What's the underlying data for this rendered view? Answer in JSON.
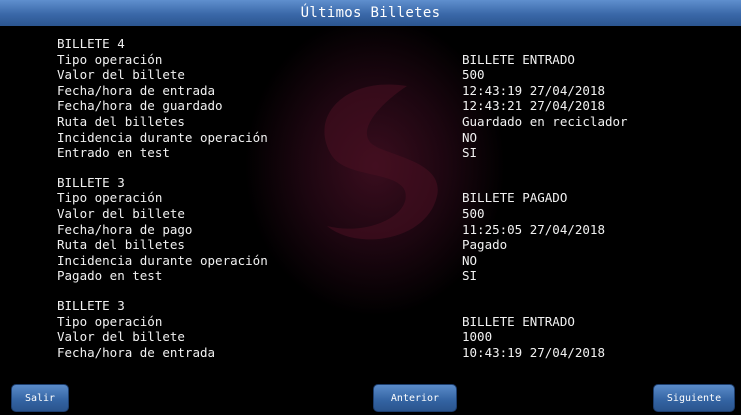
{
  "header": {
    "title": "Últimos Billetes"
  },
  "records": [
    {
      "title": "BILLETE 4",
      "rows": [
        {
          "label": "Tipo operación",
          "value": "BILLETE ENTRADO"
        },
        {
          "label": "Valor del billete",
          "value": "500"
        },
        {
          "label": "Fecha/hora de entrada",
          "value": "12:43:19 27/04/2018"
        },
        {
          "label": "Fecha/hora de guardado",
          "value": "12:43:21 27/04/2018"
        },
        {
          "label": "Ruta del billetes",
          "value": "Guardado en reciclador"
        },
        {
          "label": "Incidencia durante operación",
          "value": "NO"
        },
        {
          "label": "Entrado en test",
          "value": "SI"
        }
      ]
    },
    {
      "title": "BILLETE 3",
      "rows": [
        {
          "label": "Tipo operación",
          "value": "BILLETE PAGADO"
        },
        {
          "label": "Valor del billete",
          "value": "500"
        },
        {
          "label": "Fecha/hora de pago",
          "value": "11:25:05 27/04/2018"
        },
        {
          "label": "Ruta del billetes",
          "value": "Pagado"
        },
        {
          "label": "Incidencia durante operación",
          "value": "NO"
        },
        {
          "label": "Pagado en test",
          "value": "SI"
        }
      ]
    },
    {
      "title": "BILLETE 3",
      "rows": [
        {
          "label": "Tipo operación",
          "value": "BILLETE ENTRADO"
        },
        {
          "label": "Valor del billete",
          "value": "1000"
        },
        {
          "label": "Fecha/hora de entrada",
          "value": "10:43:19 27/04/2018"
        }
      ]
    }
  ],
  "buttons": {
    "exit_label": "Salir",
    "prev_label": "Anterior",
    "next_label": "Siguiente"
  },
  "colors": {
    "titlebar": "#3a68a8",
    "button": "#3363a2",
    "background": "#000000",
    "text": "#f2f2f2",
    "logo": "#5a1428"
  },
  "icons": {
    "background_logo": "s-logo-watermark"
  }
}
